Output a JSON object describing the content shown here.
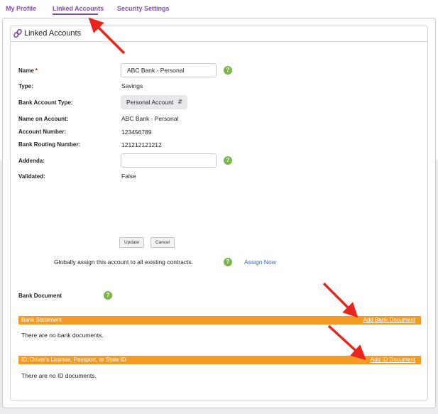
{
  "nav": {
    "tabs": [
      {
        "label": "My Profile"
      },
      {
        "label": "Linked Accounts"
      },
      {
        "label": "Security Settings"
      }
    ]
  },
  "card": {
    "title": "Linked Accounts"
  },
  "form": {
    "name_label": "Name",
    "name_required": "*",
    "name_value": "ABC Bank - Personal",
    "type_label": "Type:",
    "type_value": "Savings",
    "bank_account_type_label": "Bank Account Type:",
    "bank_account_type_value": "Personal Account",
    "name_on_account_label": "Name on Account:",
    "name_on_account_value": "ABC Bank - Personal",
    "account_number_label": "Account Number:",
    "account_number_value": "123456789",
    "routing_label": "Bank Routing Number:",
    "routing_value": "121212121212",
    "addenda_label": "Addenda:",
    "addenda_value": "",
    "validated_label": "Validated:",
    "validated_value": "False",
    "help_glyph": "?"
  },
  "actions": {
    "update_label": "Update",
    "cancel_label": "Cancel",
    "assign_text": "Globally assign this account to all existing contracts.",
    "assign_link": "Assign Now"
  },
  "documents": {
    "section_label": "Bank Document",
    "bank_statement": {
      "title": "Bank Statement",
      "link": "Add Bank Document",
      "empty": "There are no bank documents."
    },
    "id_docs": {
      "title": "ID: Driver's License, Passport, or State ID",
      "link": "Add ID Document",
      "empty": "There are no ID documents."
    }
  },
  "colors": {
    "accent": "#7d4ea3",
    "orange": "#f49b26",
    "help_green": "#7ab648",
    "link_blue": "#2a66c6",
    "arrow_red": "#e8261c"
  },
  "icons": {
    "card_icon": "link-icon",
    "help_icon": "help-icon",
    "select_icon": "chevron-updown-icon"
  }
}
